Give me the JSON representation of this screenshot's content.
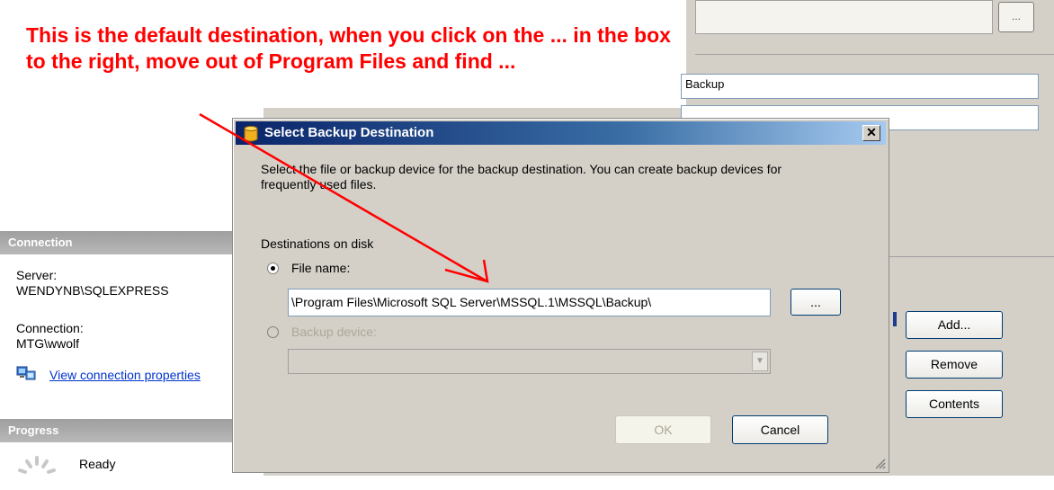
{
  "annotation": {
    "text": "This is the default destination, when you click on the ... in the box to the right, move out of Program Files and find ...",
    "color": "#ff0000"
  },
  "background": {
    "ellipsis_label": "...",
    "name_field_value": "Backup",
    "add_label": "Add...",
    "remove_label": "Remove",
    "contents_label": "Contents"
  },
  "left_panel": {
    "connection_header": "Connection",
    "server_label": "Server:",
    "server_value": "WENDYNB\\SQLEXPRESS",
    "connection_label": "Connection:",
    "connection_value": "MTG\\wwolf",
    "view_properties_link": "View connection properties",
    "progress_header": "Progress",
    "status": "Ready"
  },
  "dialog": {
    "title": "Select Backup Destination",
    "description": "Select the file or backup device for the backup destination. You can create backup devices for frequently used files.",
    "section_label": "Destinations on disk",
    "file_name_label": "File name:",
    "file_name_value": "\\Program Files\\Microsoft SQL Server\\MSSQL.1\\MSSQL\\Backup\\",
    "browse_label": "...",
    "backup_device_label": "Backup device:",
    "ok_label": "OK",
    "cancel_label": "Cancel",
    "close_label": "✕",
    "selected_option": "file_name"
  },
  "colors": {
    "titlebar_start": "#0a246a",
    "dialog_face": "#d4d0c8",
    "link": "#0033cc",
    "header_gray": "#a6a6a6"
  }
}
